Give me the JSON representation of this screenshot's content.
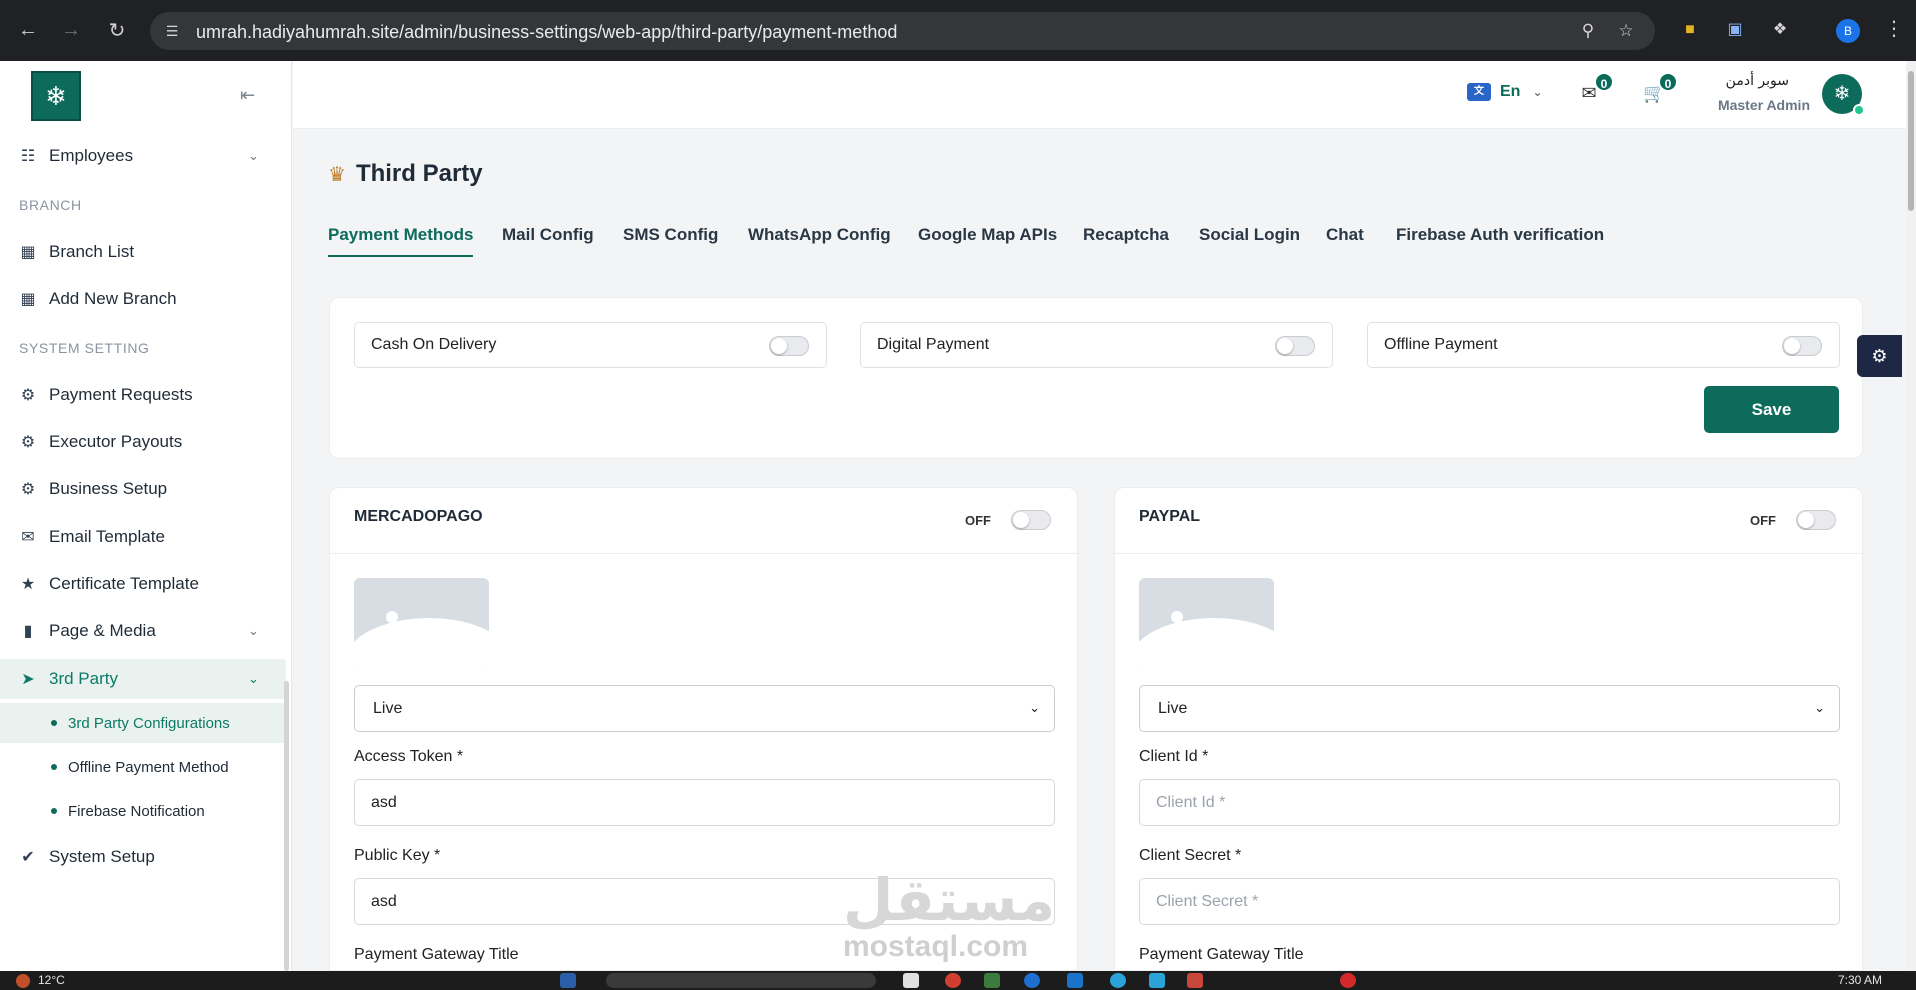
{
  "browser": {
    "url": "umrah.hadiyahumrah.site/admin/business-settings/web-app/third-party/payment-method",
    "profile_initial": "B"
  },
  "sidebar": {
    "items": [
      {
        "label": "Employees",
        "icon": "employees-icon"
      },
      {
        "label": "Branch List",
        "icon": "store-icon"
      },
      {
        "label": "Add New Branch",
        "icon": "store-icon"
      },
      {
        "label": "Payment Requests",
        "icon": "gear-icon"
      },
      {
        "label": "Executor Payouts",
        "icon": "gear-icon"
      },
      {
        "label": "Business Setup",
        "icon": "gear-icon"
      },
      {
        "label": "Email Template",
        "icon": "mail-icon"
      },
      {
        "label": "Certificate Template",
        "icon": "trophy-icon"
      },
      {
        "label": "Page & Media",
        "icon": "page-icon"
      },
      {
        "label": "3rd Party",
        "icon": "runner-icon"
      },
      {
        "label": "System Setup",
        "icon": "shield-check-icon"
      }
    ],
    "sections": {
      "branch": "BRANCH",
      "system_setting": "SYSTEM SETTING"
    },
    "sub_items": [
      {
        "label": "3rd Party Configurations"
      },
      {
        "label": "Offline Payment Method"
      },
      {
        "label": "Firebase Notification"
      }
    ]
  },
  "header": {
    "language": "En",
    "messages_count": "0",
    "cart_count": "0",
    "user_name": "سوبر أدمن",
    "user_role": "Master Admin"
  },
  "page": {
    "title": "Third Party",
    "tabs": [
      {
        "label": "Payment Methods"
      },
      {
        "label": "Mail Config"
      },
      {
        "label": "SMS Config"
      },
      {
        "label": "WhatsApp Config"
      },
      {
        "label": "Google Map APIs"
      },
      {
        "label": "Recaptcha"
      },
      {
        "label": "Social Login"
      },
      {
        "label": "Chat"
      },
      {
        "label": "Firebase Auth verification"
      }
    ],
    "payment_toggles": [
      {
        "label": "Cash On Delivery"
      },
      {
        "label": "Digital Payment"
      },
      {
        "label": "Offline Payment"
      }
    ],
    "save_label": "Save"
  },
  "gateways": {
    "mercadopago": {
      "title": "MERCADOPAGO",
      "status": "OFF",
      "mode": "Live",
      "field1_label": "Access Token *",
      "field1_value": "asd",
      "field2_label": "Public Key *",
      "field2_value": "asd",
      "field3_label": "Payment Gateway Title"
    },
    "paypal": {
      "title": "PAYPAL",
      "status": "OFF",
      "mode": "Live",
      "field1_label": "Client Id *",
      "field1_placeholder": "Client Id *",
      "field2_label": "Client Secret *",
      "field2_placeholder": "Client Secret *",
      "field3_label": "Payment Gateway Title"
    }
  },
  "watermark": {
    "arabic": "مستقل",
    "latin": "mostaql.com"
  },
  "taskbar": {
    "temperature": "12°C",
    "time": "7:30 AM"
  },
  "colors": {
    "brand": "#0c6b5b",
    "active_bg": "#e9f2ef",
    "float_button": "#1e2744"
  }
}
